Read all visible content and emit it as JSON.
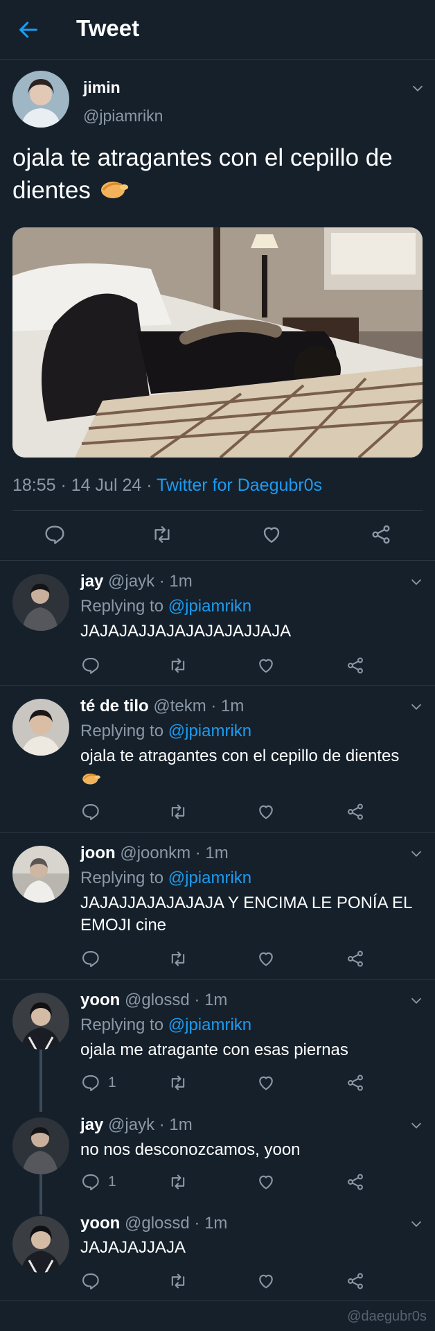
{
  "header": {
    "title": "Tweet"
  },
  "main_tweet": {
    "name": "jimin",
    "handle": "@jpiamrikn",
    "text": "ojala te atragantes con el cepillo de dientes",
    "emoji_icon": "pinching-hand-icon",
    "time": "18:55",
    "date": "14 Jul 24",
    "source": "Twitter for Daegubr0s"
  },
  "replies": [
    {
      "name": "jay",
      "handle": "@jayk",
      "time": "1m",
      "replying_label": "Replying to ",
      "replying_to": "@jpiamrikn",
      "text": "JAJAJAJJAJAJAJAJAJJAJA",
      "reply_count": ""
    },
    {
      "name": "té de tilo",
      "handle": "@tekm",
      "time": "1m",
      "replying_label": "Replying to ",
      "replying_to": "@jpiamrikn",
      "text": "ojala te atragantes con el cepillo de dientes",
      "emoji_icon": "pinching-hand-icon",
      "reply_count": ""
    },
    {
      "name": "joon",
      "handle": "@joonkm",
      "time": "1m",
      "replying_label": "Replying to ",
      "replying_to": "@jpiamrikn",
      "text": "JAJAJJAJAJAJAJA Y ENCIMA LE PONÍA EL EMOJI cine",
      "reply_count": ""
    },
    {
      "name": "yoon",
      "handle": "@glossd",
      "time": "1m",
      "replying_label": "Replying to ",
      "replying_to": "@jpiamrikn",
      "text": "ojala me atragante con esas piernas",
      "reply_count": "1"
    },
    {
      "name": "jay",
      "handle": "@jayk",
      "time": "1m",
      "text": "no nos desconozcamos, yoon",
      "reply_count": "1"
    },
    {
      "name": "yoon",
      "handle": "@glossd",
      "time": "1m",
      "text": "JAJAJAJJAJA",
      "reply_count": ""
    }
  ],
  "watermark": "@daegubr0s",
  "colors": {
    "background": "#15202b",
    "accent": "#1d9bf0",
    "secondary_text": "#8b98a5",
    "divider": "#2a3642"
  }
}
